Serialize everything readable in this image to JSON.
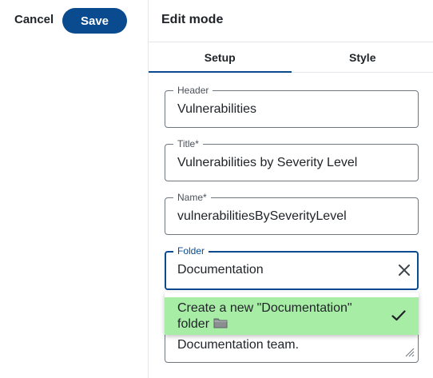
{
  "toolbar": {
    "cancel_label": "Cancel",
    "save_label": "Save"
  },
  "panel": {
    "title": "Edit mode",
    "tabs": [
      {
        "label": "Setup",
        "active": true
      },
      {
        "label": "Style",
        "active": false
      }
    ]
  },
  "form": {
    "header": {
      "label": "Header",
      "value": "Vulnerabilities"
    },
    "title": {
      "label": "Title*",
      "value": "Vulnerabilities by Severity Level"
    },
    "name": {
      "label": "Name*",
      "value": "vulnerabilitiesBySeverityLevel"
    },
    "folder": {
      "label": "Folder",
      "value": "Documentation"
    },
    "description": {
      "value": "Documentation team."
    }
  },
  "dropdown": {
    "option_label": "Create a new \"Documentation\" folder",
    "option_icon": "folder-icon",
    "selected": true,
    "highlight_color": "#a8eda6"
  },
  "colors": {
    "accent": "#0a4b90",
    "border": "#6f767e"
  }
}
